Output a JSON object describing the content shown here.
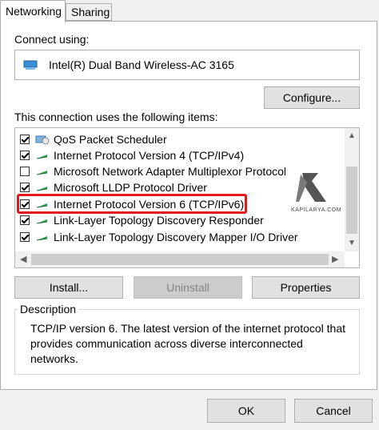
{
  "tabs": [
    {
      "label": "Networking",
      "active": true
    },
    {
      "label": "Sharing",
      "active": false
    }
  ],
  "connect_using": {
    "label": "Connect using:",
    "adapter": "Intel(R) Dual Band Wireless-AC 3165",
    "adapter_icon": "network-adapter-icon"
  },
  "configure_label": "Configure...",
  "items_label": "This connection uses the following items:",
  "items": [
    {
      "label": "QoS Packet Scheduler",
      "checked": true,
      "icon": "qos-service-icon"
    },
    {
      "label": "Internet Protocol Version 4 (TCP/IPv4)",
      "checked": true,
      "icon": "protocol-icon"
    },
    {
      "label": "Microsoft Network Adapter Multiplexor Protocol",
      "checked": false,
      "icon": "protocol-icon"
    },
    {
      "label": "Microsoft LLDP Protocol Driver",
      "checked": true,
      "icon": "protocol-icon"
    },
    {
      "label": "Internet Protocol Version 6 (TCP/IPv6)",
      "checked": true,
      "icon": "protocol-icon",
      "highlighted": true
    },
    {
      "label": "Link-Layer Topology Discovery Responder",
      "checked": true,
      "icon": "protocol-icon"
    },
    {
      "label": "Link-Layer Topology Discovery Mapper I/O Driver",
      "checked": true,
      "icon": "protocol-icon"
    }
  ],
  "watermark": {
    "text": "KAPILARYA.COM"
  },
  "buttons": {
    "install": "Install...",
    "uninstall": "Uninstall",
    "properties": "Properties"
  },
  "description": {
    "legend": "Description",
    "text": "TCP/IP version 6. The latest version of the internet protocol that provides communication across diverse interconnected networks."
  },
  "footer": {
    "ok": "OK",
    "cancel": "Cancel"
  },
  "colors": {
    "highlight_border": "#e0191e",
    "protocol_icon": "#2e9f4e"
  }
}
